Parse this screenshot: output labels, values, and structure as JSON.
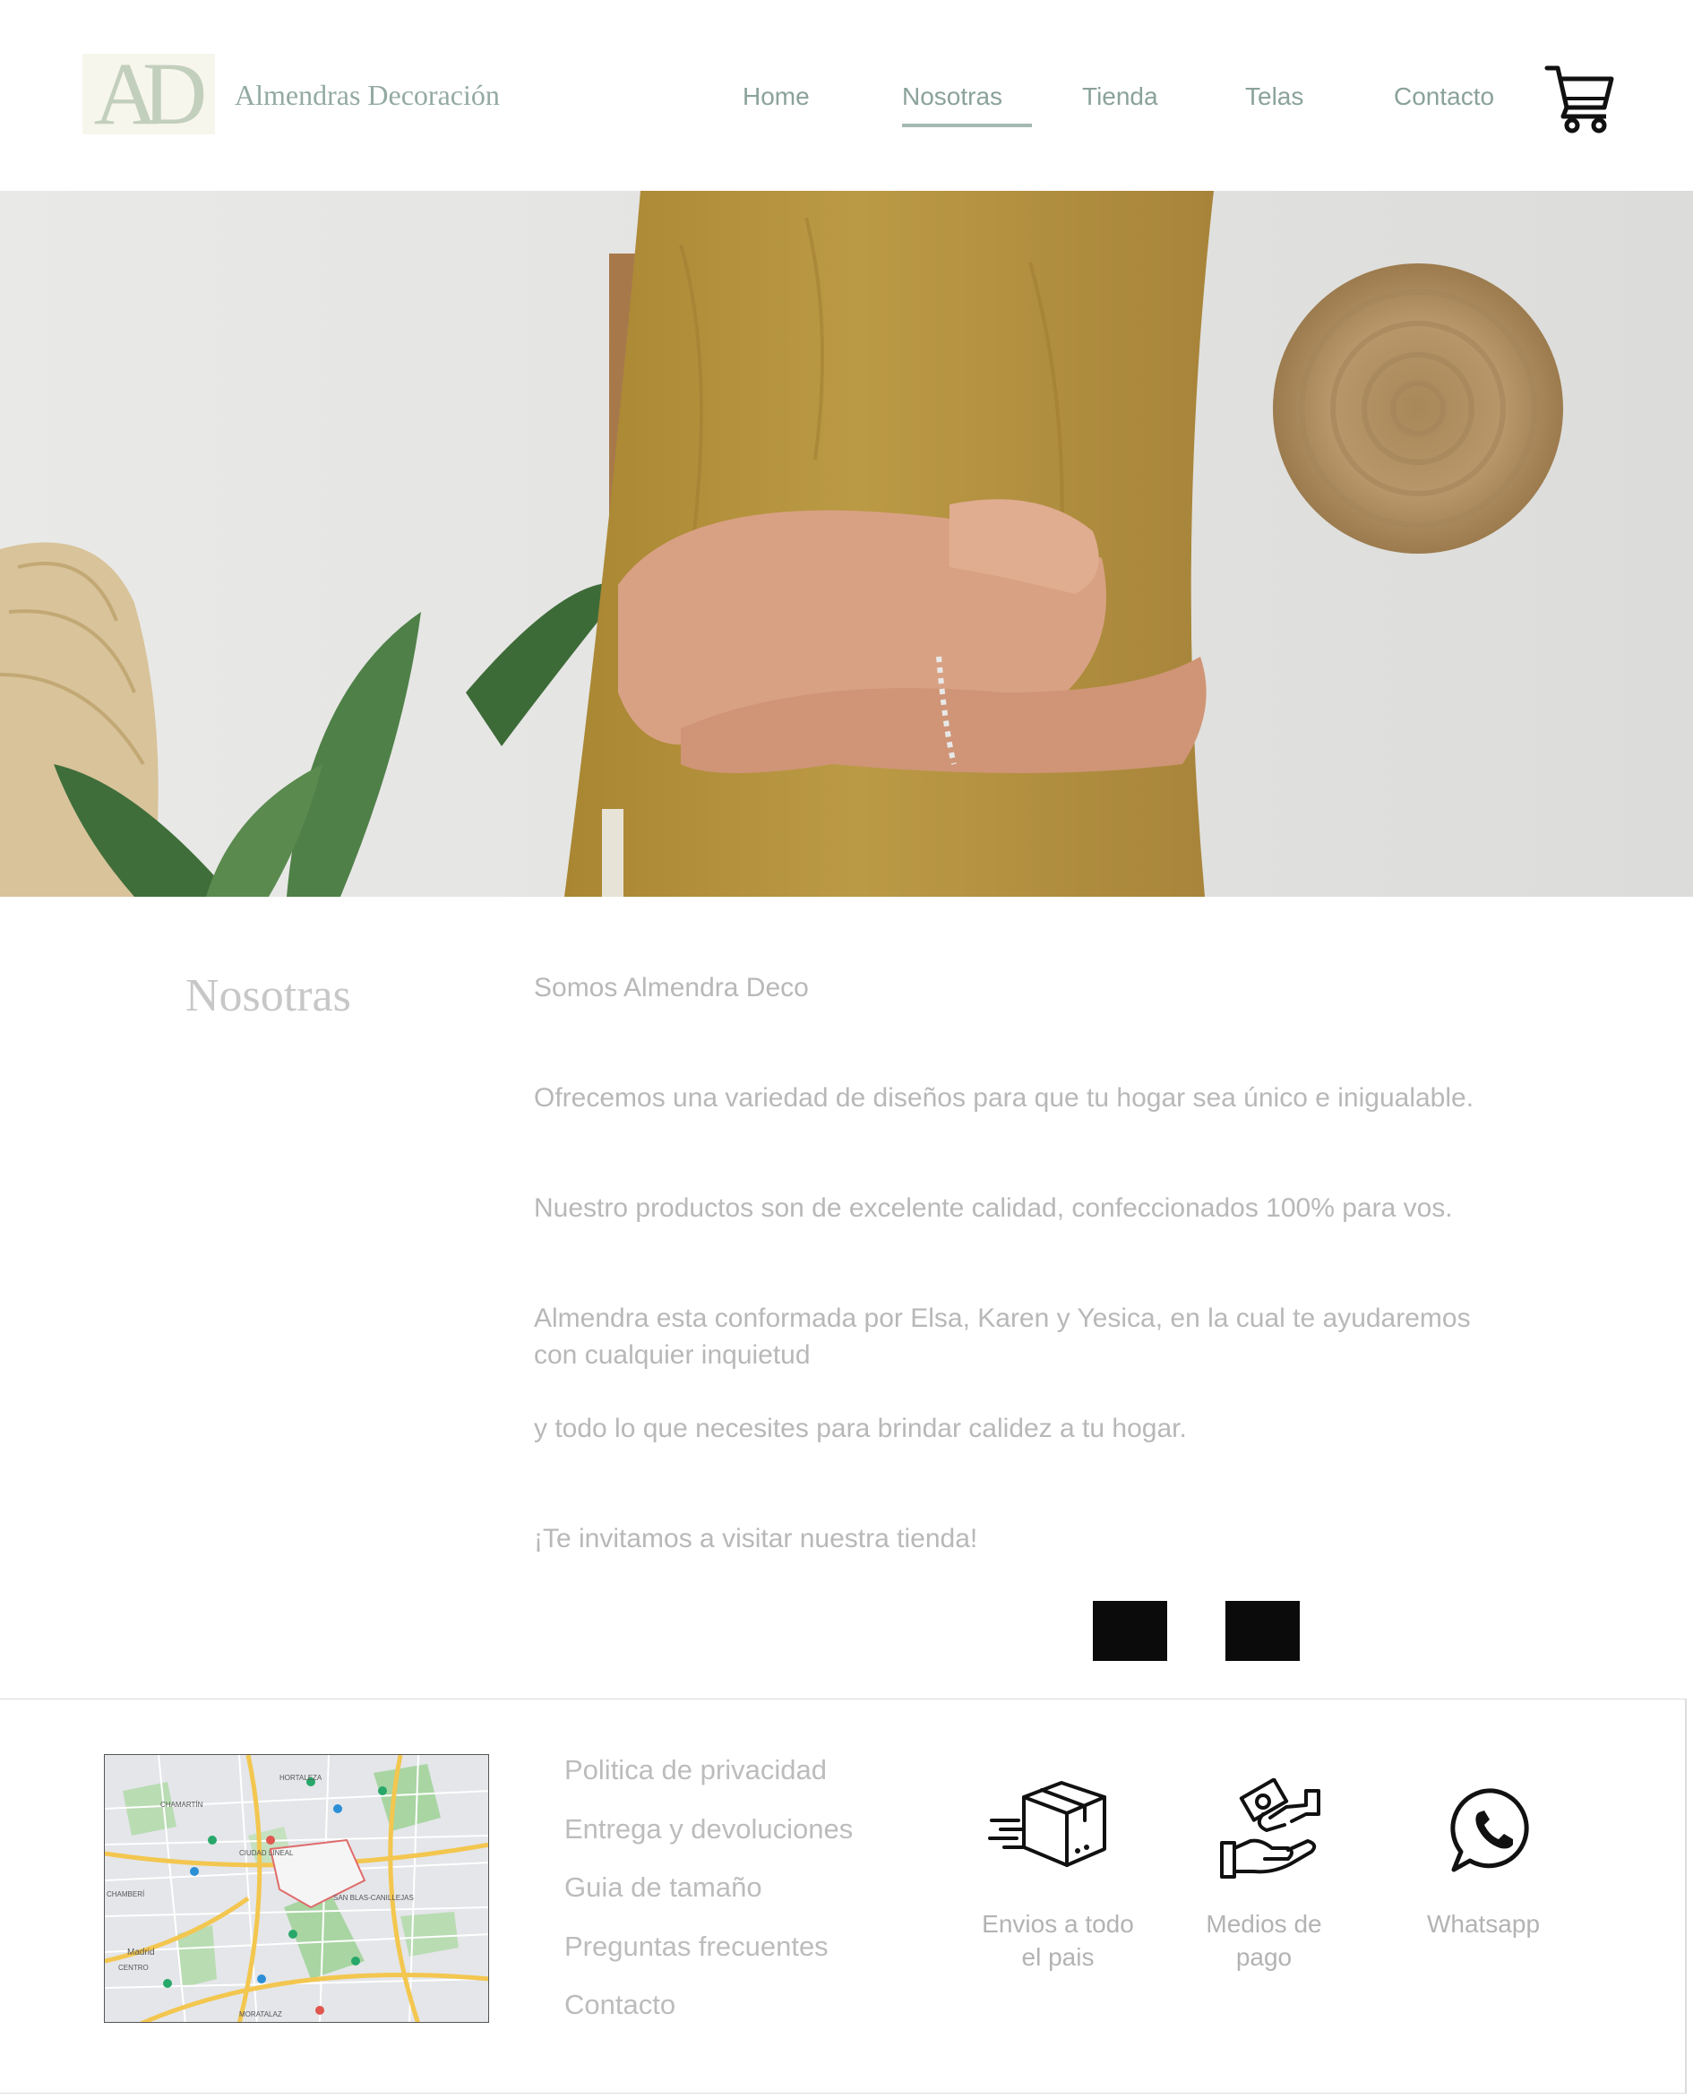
{
  "header": {
    "logo_text": "AD",
    "brand_name": "Almendras Decoración",
    "nav": [
      {
        "label": "Home"
      },
      {
        "label": "Nosotras"
      },
      {
        "label": "Tienda"
      },
      {
        "label": "Telas"
      },
      {
        "label": "Contacto"
      }
    ],
    "active_nav": "Nosotras",
    "cart_icon": "shopping-cart-icon"
  },
  "hero": {
    "image": "woman-hugging-mustard-pillow-photo"
  },
  "about": {
    "title": "Nosotras",
    "paragraphs": [
      "Somos Almendra Deco",
      "Ofrecemos una variedad de diseños para que tu hogar sea único e inigualable.",
      "Nuestro productos son de excelente calidad, confeccionados 100% para vos.",
      "Almendra esta conformada por Elsa, Karen y Yesica, en la cual te ayudaremos",
      "con cualquier inquietud",
      "y todo lo que necesites para brindar calidez a tu hogar.",
      "¡Te invitamos a visitar nuestra tienda!"
    ]
  },
  "footer": {
    "links": [
      "Politica de privacidad",
      "Entrega y devoluciones",
      "Guia de tamaño",
      "Preguntas frecuentes",
      "Contacto"
    ],
    "features": [
      {
        "icon": "shipping-box-icon",
        "line1": "Envios a todo",
        "line2": "el pais"
      },
      {
        "icon": "payment-hands-icon",
        "line1": "Medios de",
        "line2": "pago"
      },
      {
        "icon": "whatsapp-icon",
        "line1": "Whatsapp",
        "line2": ""
      }
    ],
    "map_labels": [
      "HORTALEZA",
      "CHAMARTÍN",
      "CIUDAD LINEAL",
      "SAN BLAS-CANILLEJAS",
      "CHAMBERÍ",
      "Madrid",
      "CENTRO",
      "MORATALAZ"
    ]
  },
  "colors": {
    "nav_text": "#8aa29a",
    "nav_underline": "#a3b9b1",
    "body_text": "#b8b8b8",
    "logo_bg": "#f7f6ec",
    "pillow": "#b8973f"
  }
}
